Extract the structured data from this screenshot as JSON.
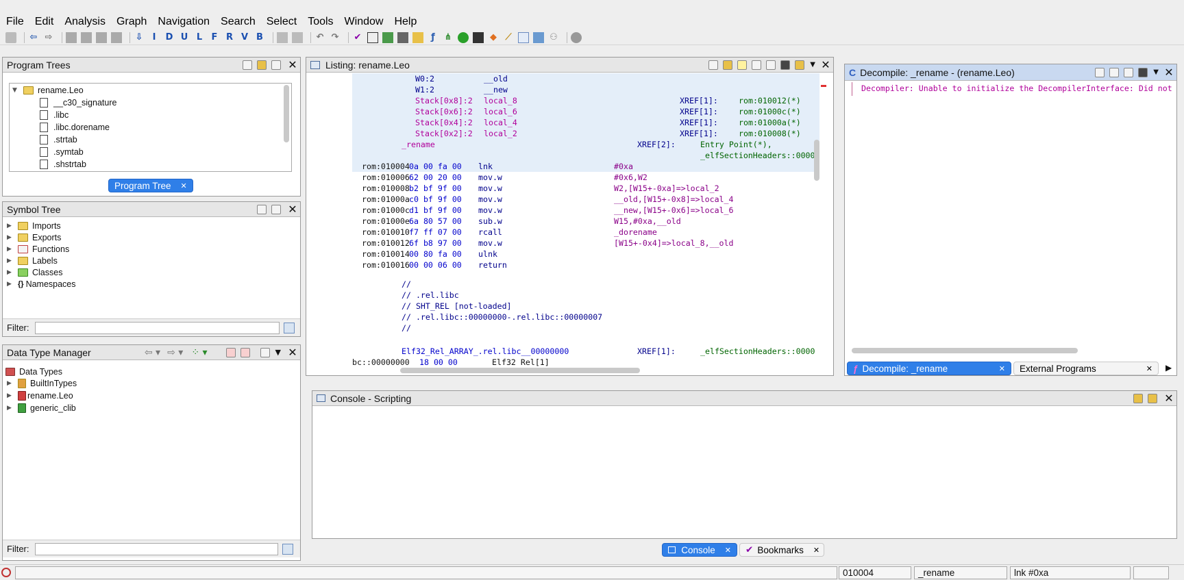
{
  "menu": [
    "File",
    "Edit",
    "Analysis",
    "Graph",
    "Navigation",
    "Search",
    "Select",
    "Tools",
    "Window",
    "Help"
  ],
  "toolbar": {
    "letters": [
      "I",
      "D",
      "U",
      "L",
      "F",
      "R",
      "V",
      "B"
    ]
  },
  "program_trees": {
    "title": "Program Trees",
    "root": "rename.Leo",
    "items": [
      "__c30_signature",
      ".libc",
      ".libc.dorename",
      ".strtab",
      ".symtab",
      ".shstrtab"
    ],
    "tab_label": "Program Tree"
  },
  "symbol_tree": {
    "title": "Symbol Tree",
    "items": [
      "Imports",
      "Exports",
      "Functions",
      "Labels",
      "Classes",
      "Namespaces"
    ],
    "filter_label": "Filter:"
  },
  "data_type_manager": {
    "title": "Data Type Manager",
    "root": "Data Types",
    "items": [
      "BuiltInTypes",
      "rename.Leo",
      "generic_clib"
    ],
    "filter_label": "Filter:"
  },
  "listing": {
    "title": "Listing:  rename.Leo",
    "header_rows": [
      {
        "reg": "W0:2",
        "name": "__old",
        "xref": "",
        "addr": ""
      },
      {
        "reg": "W1:2",
        "name": "__new",
        "xref": "",
        "addr": ""
      },
      {
        "reg": "Stack[0x8]:2",
        "name": "local_8",
        "xref": "XREF[1]:",
        "addr": "rom:010012(*)"
      },
      {
        "reg": "Stack[0x6]:2",
        "name": "local_6",
        "xref": "XREF[1]:",
        "addr": "rom:01000c(*)"
      },
      {
        "reg": "Stack[0x4]:2",
        "name": "local_4",
        "xref": "XREF[1]:",
        "addr": "rom:01000a(*)"
      },
      {
        "reg": "Stack[0x2]:2",
        "name": "local_2",
        "xref": "XREF[1]:",
        "addr": "rom:010008(*)"
      }
    ],
    "function_label": "_rename",
    "function_xref": "XREF[2]:",
    "function_xref_1": "Entry Point(*),",
    "function_xref_2": "_elfSectionHeaders::0000",
    "code_rows": [
      {
        "addr": "rom:010004",
        "bytes": "0a 00 fa 00",
        "mnem": "lnk",
        "op": "#0xa"
      },
      {
        "addr": "rom:010006",
        "bytes": "62 00 20 00",
        "mnem": "mov.w",
        "op": "#0x6,W2"
      },
      {
        "addr": "rom:010008",
        "bytes": "b2 bf 9f 00",
        "mnem": "mov.w",
        "op": "W2,[W15+-0xa]=>local_2"
      },
      {
        "addr": "rom:01000a",
        "bytes": "c0 bf 9f 00",
        "mnem": "mov.w",
        "op": "__old,[W15+-0x8]=>local_4"
      },
      {
        "addr": "rom:01000c",
        "bytes": "d1 bf 9f 00",
        "mnem": "mov.w",
        "op": "__new,[W15+-0x6]=>local_6"
      },
      {
        "addr": "rom:01000e",
        "bytes": "6a 80 57 00",
        "mnem": "sub.w",
        "op": "W15,#0xa,__old"
      },
      {
        "addr": "rom:010010",
        "bytes": "f7 ff 07 00",
        "mnem": "rcall",
        "op": "_dorename"
      },
      {
        "addr": "rom:010012",
        "bytes": "6f b8 97 00",
        "mnem": "mov.w",
        "op": "[W15+-0x4]=>local_8,__old"
      },
      {
        "addr": "rom:010014",
        "bytes": "00 80 fa 00",
        "mnem": "ulnk",
        "op": ""
      },
      {
        "addr": "rom:010016",
        "bytes": "00 00 06 00",
        "mnem": "return",
        "op": ""
      }
    ],
    "comments": [
      "//",
      "// .rel.libc",
      "// SHT_REL [not-loaded]",
      "// .rel.libc::00000000-.rel.libc::00000007",
      "//"
    ],
    "array_label": "Elf32_Rel_ARRAY_.rel.libc__00000000",
    "array_xref": "XREF[1]:",
    "array_xref_addr": "_elfSectionHeaders::0000",
    "last_row_addr": "bc::00000000",
    "last_row_bytes": "18 00 00",
    "last_row_type": "Elf32_Rel[1]"
  },
  "decompile": {
    "title": "Decompile: _rename -  (rename.Leo)",
    "message": "Decompiler: Unable to initialize the DecompilerInterface: Did not",
    "tab_active": "Decompile: _rename",
    "tab_other": "External Programs"
  },
  "console": {
    "title": "Console - Scripting",
    "tab_active": "Console",
    "tab_other": "Bookmarks"
  },
  "status": {
    "address": "010004",
    "function": "_rename",
    "instruction": "lnk #0xa"
  },
  "colors": {
    "accent": "#2f7fe8",
    "highlight_row": "#e4eef9"
  }
}
